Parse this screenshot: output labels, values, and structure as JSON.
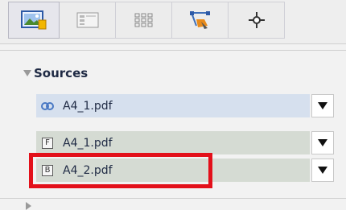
{
  "toolbar": {
    "tabs": [
      {
        "icon": "image-landscape-icon",
        "selected": true
      },
      {
        "icon": "layout-grid-icon",
        "selected": false
      },
      {
        "icon": "dotted-grid-icon",
        "selected": false
      },
      {
        "icon": "path-edit-icon",
        "selected": false
      },
      {
        "icon": "crosshair-icon",
        "selected": false
      }
    ]
  },
  "sources": {
    "title": "Sources",
    "rows": [
      {
        "badge": "",
        "icon": "link-icon",
        "label": "A4_1.pdf"
      },
      {
        "badge": "F",
        "icon": "letter-f-icon",
        "label": "A4_1.pdf"
      },
      {
        "badge": "B",
        "icon": "letter-b-icon",
        "label": "A4_2.pdf"
      }
    ]
  },
  "colors": {
    "highlight": "#e3101a",
    "selected_row_bg": "#d6e0ee",
    "row_bg": "#d5dbd3",
    "text": "#1f2a44"
  }
}
